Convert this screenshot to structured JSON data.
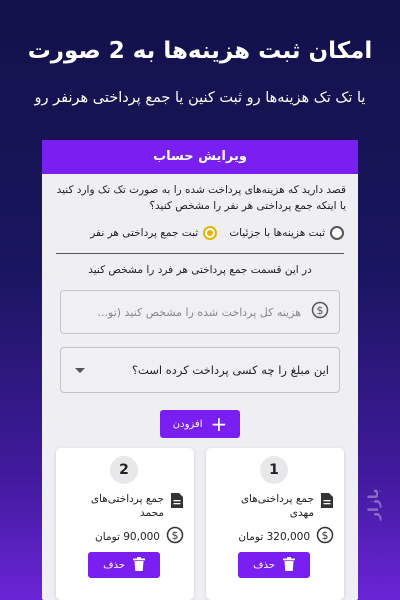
{
  "promo": {
    "headline": "امکان ثبت هزینه‌ها به 2 صورت",
    "subline": "یا تک تک هزینه‌ها رو ثبت کنین یا جمع پرداختی هرنفر رو"
  },
  "dialog": {
    "title": "ویرایش حساب",
    "question": "قصد دارید که هزینه‌های پرداخت شده را به صورت تک تک وارد کنید یا اینکه جمع پرداختی هر نفر را مشخص کنید؟",
    "options": [
      {
        "label": "ثبت هزینه‌ها با جزئیات",
        "selected": false
      },
      {
        "label": "ثبت جمع پرداختی هر نفر",
        "selected": true
      }
    ],
    "instruction": "در این قسمت جمع پرداختی هر فرد را مشخص کنید",
    "amount_placeholder": "هزینه کل پرداخت شده را مشخص کنید (تو...",
    "payer_question": "این مبلغ را چه کسی پرداخت کرده است؟",
    "add_label": "افزودن"
  },
  "entries": [
    {
      "number": "1",
      "title": "جمع پرداختی‌های مهدی",
      "amount": "320,000 تومان",
      "delete_label": "حذف"
    },
    {
      "number": "2",
      "title": "جمع پرداختی‌های محمد",
      "amount": "90,000 تومان",
      "delete_label": "حذف"
    }
  ],
  "colors": {
    "accent": "#7a1ff2",
    "selected_radio": "#e6b400"
  },
  "watermark": "بازار"
}
